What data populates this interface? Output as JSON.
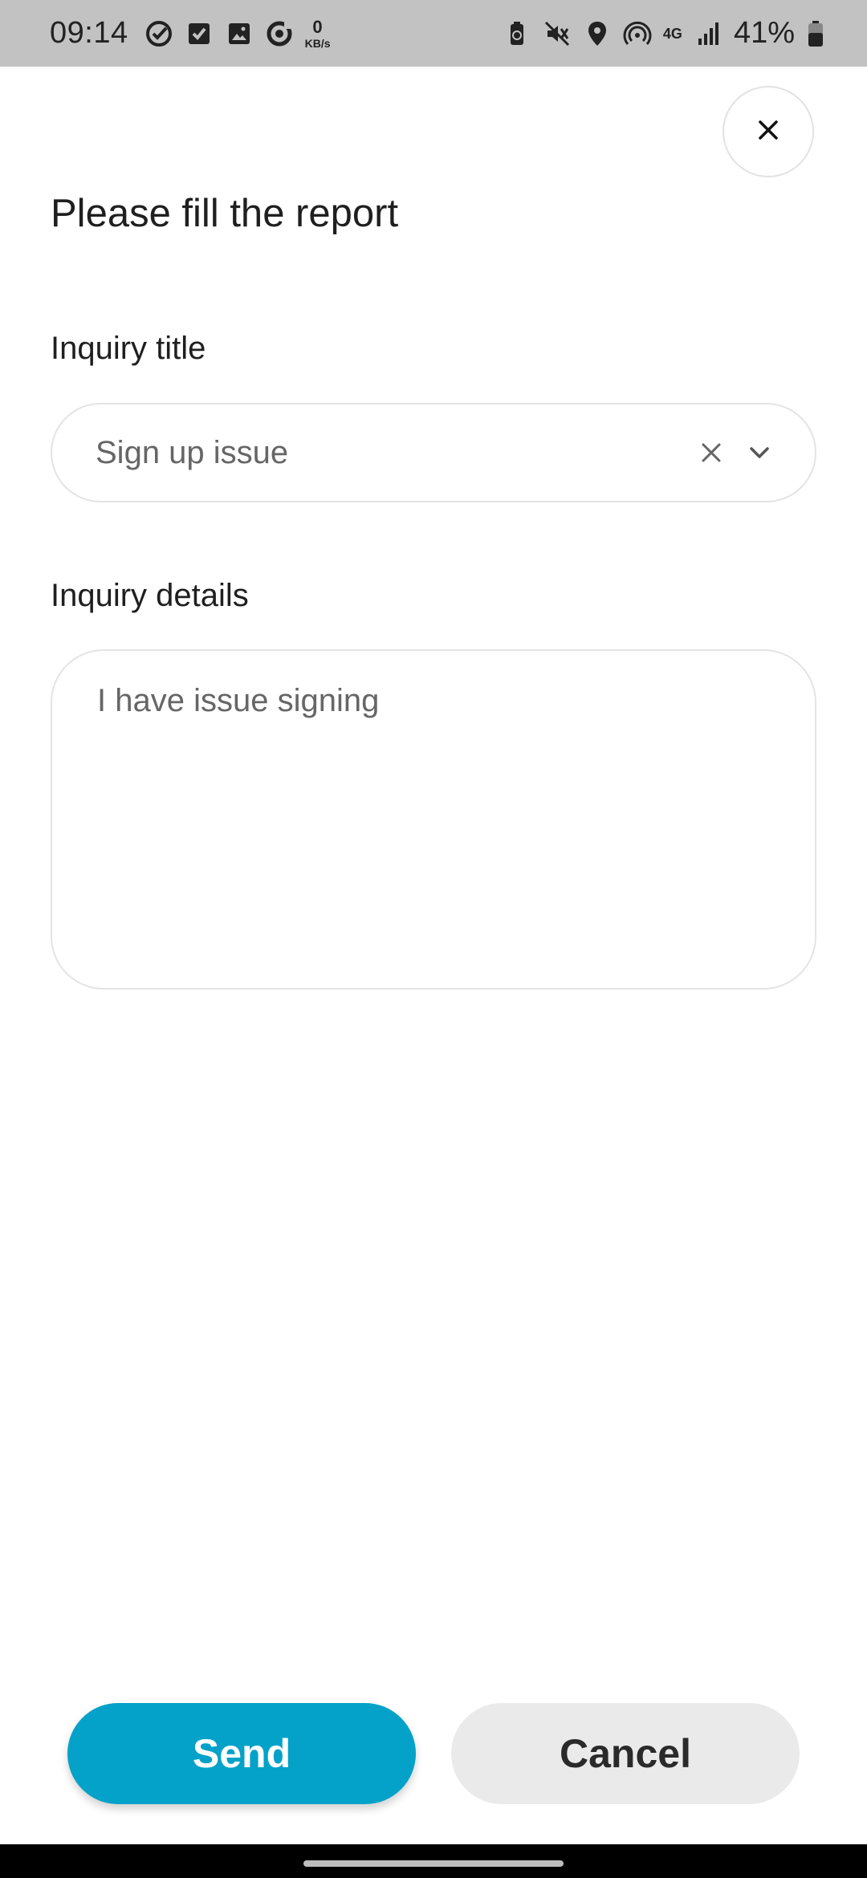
{
  "status_bar": {
    "time": "09:14",
    "speed_value": "0",
    "speed_unit": "KB/s",
    "network_type": "4G",
    "battery_percent": "41%",
    "left_icons": [
      "check-circle-icon",
      "checkbox-icon",
      "gallery-icon",
      "sync-icon"
    ],
    "right_icons": [
      "battery-saver-icon",
      "mute-icon",
      "location-icon",
      "hotspot-icon",
      "signal-icon",
      "battery-icon"
    ]
  },
  "dialog": {
    "title": "Please fill the report",
    "close_icon": "close-icon"
  },
  "form": {
    "inquiry_title_label": "Inquiry title",
    "inquiry_title_value": "Sign up issue",
    "inquiry_details_label": "Inquiry details",
    "inquiry_details_value": "I have issue signing"
  },
  "actions": {
    "send_label": "Send",
    "cancel_label": "Cancel"
  },
  "colors": {
    "accent": "#04a2c8",
    "status_bar_bg": "#c2c2c2",
    "cancel_bg": "#eaeaea"
  }
}
